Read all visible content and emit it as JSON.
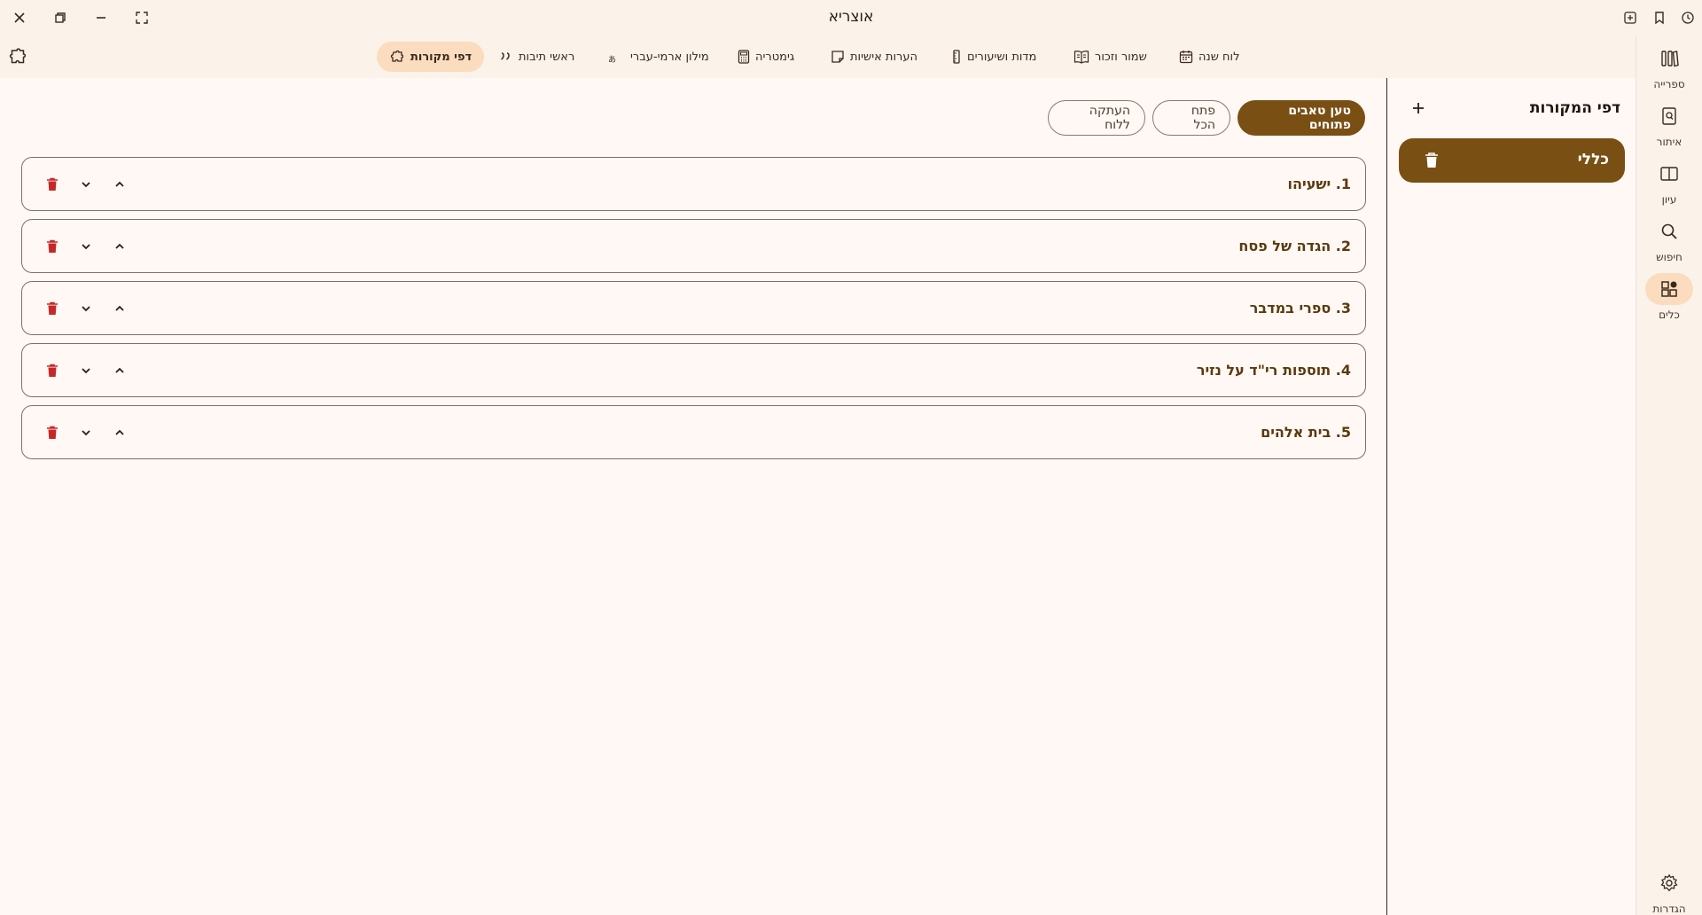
{
  "app": {
    "title": "אוצריא"
  },
  "toolbar": {
    "items": [
      {
        "label": "לוח שנה",
        "icon": "calendar-icon"
      },
      {
        "label": "שמור וזכור",
        "icon": "open-book-icon"
      },
      {
        "label": "מדות ושיעורים",
        "icon": "ruler-icon"
      },
      {
        "label": "הערות אישיות",
        "icon": "note-icon"
      },
      {
        "label": "גימטריה",
        "icon": "calculator-icon"
      },
      {
        "label": "מילון ארמי-עברי",
        "icon": "translate-icon"
      },
      {
        "label": "ראשי תיבות",
        "icon": "quote-icon"
      },
      {
        "label": "דפי מקורות",
        "icon": "puzzle-icon"
      }
    ],
    "active": "דפי מקורות"
  },
  "rail": {
    "items": [
      {
        "label": "ספרייה",
        "icon": "library-icon"
      },
      {
        "label": "איתור",
        "icon": "find-book-icon"
      },
      {
        "label": "עיון",
        "icon": "reading-icon"
      },
      {
        "label": "חיפוש",
        "icon": "search-icon"
      },
      {
        "label": "כלים",
        "icon": "tools-icon"
      }
    ],
    "settings_label": "הגדרות",
    "active": "כלים"
  },
  "side_panel": {
    "title": "דפי המקורות",
    "items": [
      {
        "label": "כללי"
      }
    ]
  },
  "actions": {
    "load_tabs": "טען טאבים פתוחים",
    "open_all": "פתח הכל",
    "copy_clipboard": "העתקה ללוח"
  },
  "sources": [
    {
      "title": "1. ישעיהו"
    },
    {
      "title": "2. הגדה של פסח"
    },
    {
      "title": "3. ספרי במדבר"
    },
    {
      "title": "4. תוספות רי\"ד על נזיר"
    },
    {
      "title": "5. בית אלהים"
    }
  ],
  "colors": {
    "accent": "#7a4f14",
    "accent_light": "#fbdcbf",
    "delete": "#c62828",
    "background": "#fff8f4",
    "toolbar_bg": "#fbf2ea"
  }
}
